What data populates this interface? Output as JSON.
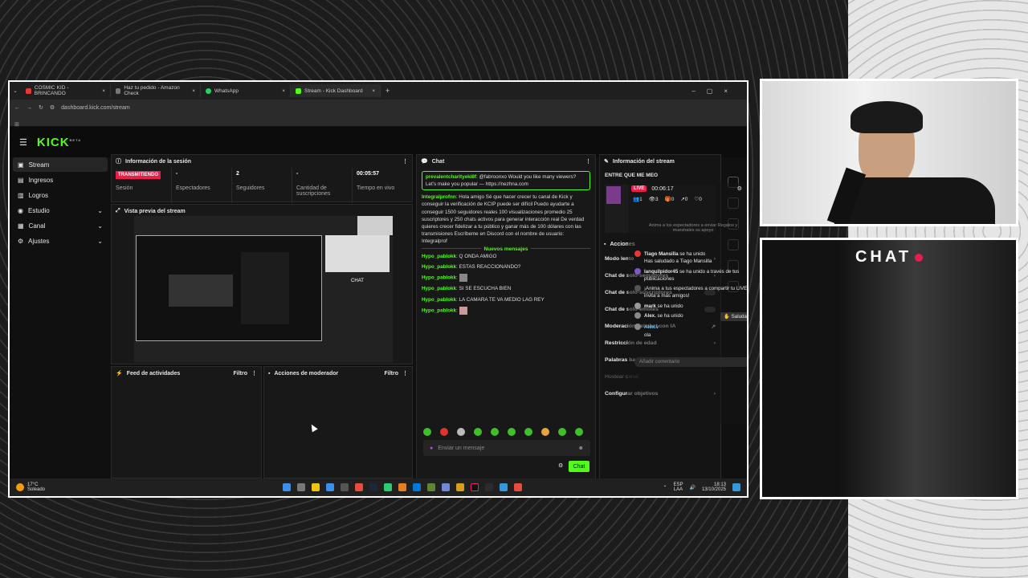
{
  "browser": {
    "tabs": [
      {
        "label": "COSMIC KID - BRINCANDO",
        "color": "#e53935"
      },
      {
        "label": "Haz tu pedido - Amazon Check",
        "color": "#555"
      },
      {
        "label": "WhatsApp",
        "color": "#25d366"
      },
      {
        "label": "Stream - Kick Dashboard",
        "color": "#53fc18"
      }
    ],
    "url": "dashboard.kick.com/stream"
  },
  "kick": {
    "logo": "KICK",
    "beta": "BETA"
  },
  "sidebar": {
    "items": [
      {
        "label": "Stream",
        "active": true
      },
      {
        "label": "Ingresos"
      },
      {
        "label": "Logros"
      },
      {
        "label": "Estudio",
        "chevron": true
      },
      {
        "label": "Canal",
        "chevron": true
      },
      {
        "label": "Ajustes",
        "chevron": true
      }
    ]
  },
  "session": {
    "title": "Información de la sesión",
    "badge": "TRANSMITIENDO",
    "stats": [
      {
        "value": "",
        "label": "Sesión"
      },
      {
        "value": "-",
        "label": "Espectadores"
      },
      {
        "value": "2",
        "label": "Seguidores"
      },
      {
        "value": "-",
        "label": "Cantidad de suscripciones"
      },
      {
        "value": "00:05:57",
        "label": "Tiempo en vivo"
      }
    ]
  },
  "preview": {
    "title": "Vista previa del stream",
    "inner_chat": "CHAT"
  },
  "feed": {
    "title": "Feed de actividades",
    "filter": "Filtro"
  },
  "mod": {
    "title": "Acciones de moderador",
    "filter": "Filtro"
  },
  "chat": {
    "title": "Chat",
    "pinned": {
      "user": "prevalentcharityeki8f",
      "text": "@fabroonxo Would you like many viewers? Let's make you popular — https://nezhna.com"
    },
    "msg2": {
      "user": "Integralprofnn",
      "text": "Hola amigo Sé que hacer crecer tu canal de Kick y conseguir la verificación de KCIP puede ser difícil Puedo ayudarte a conseguir 1500 seguidores reales 100 visualizaciones promedio 25 suscriptores y 250 chats activos para generar interacción real De verdad quieres crecer fidelizar a tu público y ganar más de 100 dólares con las transmisiones Escríbeme en Discord con el nombre de usuario: Integralprof"
    },
    "new_divider": "Nuevos mensajes",
    "messages": [
      {
        "user": "Hypo_pablokk",
        "text": "Q ONDA AMIGO"
      },
      {
        "user": "Hypo_pablokk",
        "text": "ESTAS REACCIONANDO?"
      },
      {
        "user": "Hypo_pablokk",
        "text": ""
      },
      {
        "user": "Hypo_pablokk",
        "text": "SI SE ESCUCHA BIEN"
      },
      {
        "user": "Hypo_pablokk",
        "text": "LA CAMARA TE VA MEDIO LAG REY"
      },
      {
        "user": "Hypo_pablokk",
        "text": ""
      }
    ],
    "placeholder": "Enviar un mensaje",
    "send": "Chat"
  },
  "info": {
    "title": "Información del stream",
    "entry": "ENTRE QUE ME MEO",
    "actions_title": "Acciones",
    "rows": [
      {
        "label": "Modo lento",
        "type": "chev"
      },
      {
        "label": "Chat de solo-seguidores",
        "type": "chev"
      },
      {
        "label": "Chat de solo-suscriptores",
        "type": "toggle"
      },
      {
        "label": "Chat de solo-emotes",
        "type": "toggle"
      },
      {
        "label": "Moderación del chat con IA",
        "type": "ext"
      },
      {
        "label": "Restricción de edad",
        "type": "chev"
      },
      {
        "label": "Palabras baneadas",
        "type": "chev"
      },
      {
        "label": "Hostear canal",
        "type": "dim"
      },
      {
        "label": "Configurar objetivos",
        "type": "chev"
      }
    ]
  },
  "overlay": {
    "live": "LIVE",
    "timer": "00:06:17",
    "stats": [
      "1",
      "3",
      "0",
      "0",
      "0"
    ],
    "invite": "Anima a los espectadores a enviar Regalos y muestrales su apoyo",
    "feed": [
      {
        "user": "Tiago Mansilla",
        "text": "se ha unido",
        "sub": "Has saludado a Tiago Mansilla",
        "color": "#e53935"
      },
      {
        "user": "lanquilpidor45",
        "text": "se ha unido a través de tus publicaciones",
        "color": "#7e57c2"
      },
      {
        "user": "",
        "text": "¡Anima a tus espectadores a compartir tu LIVE e invita a más amigos!",
        "color": "#555"
      },
      {
        "user": "mark",
        "text": "se ha unido",
        "color": "#999"
      },
      {
        "user": "Alex.",
        "text": "se ha unido",
        "color": "#888"
      },
      {
        "user": "Alex.v",
        "text": "ola",
        "color": "#888"
      }
    ],
    "greet": "Saludar",
    "comment": "Añadir comentario"
  },
  "taskbar": {
    "weather_temp": "17°C",
    "weather_desc": "Soleado",
    "lang": "ESP",
    "lang2": "LAA",
    "time": "18:13",
    "date": "13/10/2025"
  },
  "chat_overlay": {
    "title": "CHAT"
  }
}
